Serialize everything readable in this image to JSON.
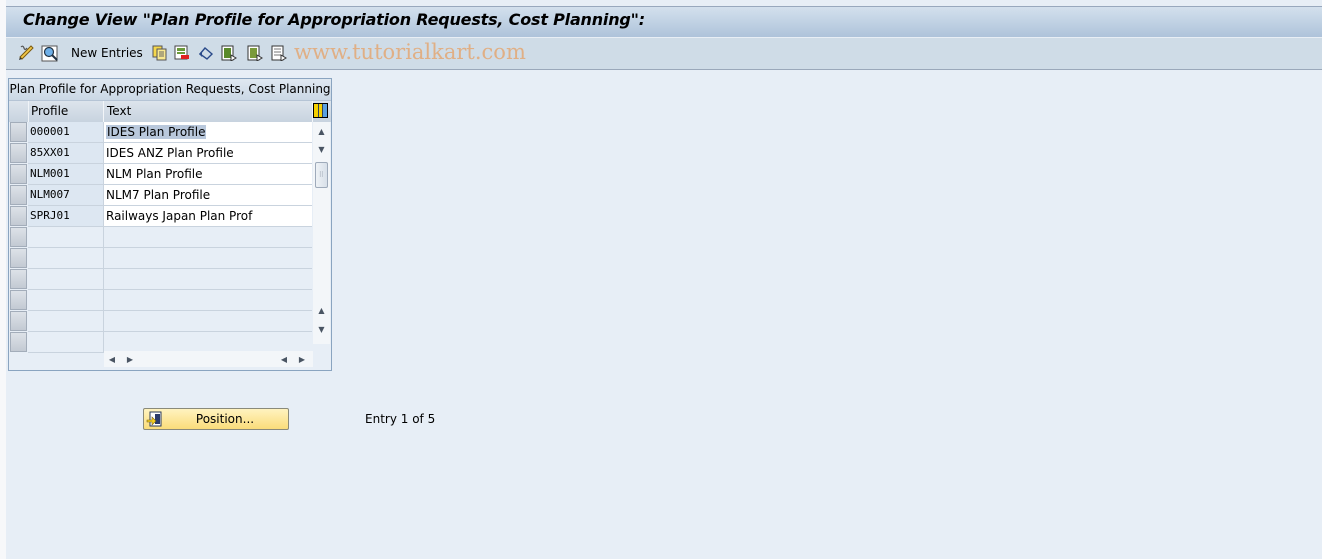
{
  "window": {
    "title": "Change View \"Plan Profile for Appropriation Requests, Cost Planning\":"
  },
  "toolbar": {
    "items": [
      {
        "icon": "change-display-icon",
        "label": ""
      },
      {
        "icon": "find-icon",
        "label": ""
      },
      {
        "icon": "",
        "label": "New Entries"
      },
      {
        "icon": "copy-as-icon",
        "label": ""
      },
      {
        "icon": "delete-icon",
        "label": ""
      },
      {
        "icon": "undo-change-icon",
        "label": ""
      },
      {
        "icon": "select-all-icon",
        "label": ""
      },
      {
        "icon": "select-block-icon",
        "label": ""
      },
      {
        "icon": "deselect-all-icon",
        "label": ""
      }
    ],
    "watermark": "www.tutorialkart.com"
  },
  "table": {
    "title": "Plan Profile for Appropriation Requests, Cost Planning",
    "columns": [
      "Profile",
      "Text"
    ],
    "rows": [
      {
        "profile": "000001",
        "text": "IDES Plan Profile",
        "selected_text": true
      },
      {
        "profile": "85XX01",
        "text": "IDES ANZ Plan Profile"
      },
      {
        "profile": "NLM001",
        "text": "NLM Plan Profile"
      },
      {
        "profile": "NLM007",
        "text": "NLM7 Plan Profile"
      },
      {
        "profile": "SPRJ01",
        "text": "Railways Japan Plan Prof"
      }
    ],
    "empty_rows": 6
  },
  "footer": {
    "position_button": "Position...",
    "entry_info": "Entry 1 of 5"
  },
  "colors": {
    "background": "#e7eef6",
    "titlebar": "#aec3da",
    "toolbar": "#cfdce7",
    "button": "#fadc7a",
    "selection": "#b9c8dc"
  }
}
